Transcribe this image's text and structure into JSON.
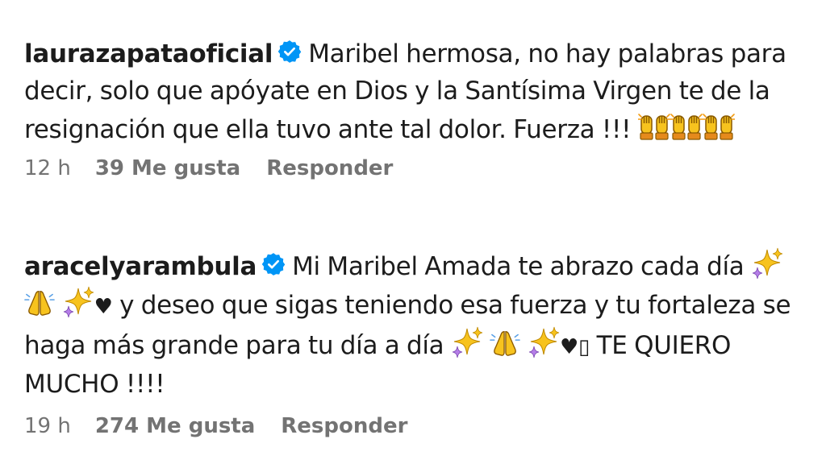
{
  "comments": [
    {
      "username": "laurazapataoficial",
      "text_before": "Maribel hermosa, no hay palabras para decir, solo que apóyate en Dios y la Santísima Virgen te de la resignación que ella tuvo ante tal dolor. Fuerza !!!",
      "time": "12 h",
      "likes": "39 Me gusta",
      "reply": "Responder",
      "icons": [
        "verified-badge-icon",
        "raising-hands-icon",
        "raising-hands-icon",
        "raising-hands-icon"
      ]
    },
    {
      "username": "aracelyarambula",
      "text_part1": "Mi Maribel Amada te abrazo cada día",
      "heart1": "♥",
      "text_part2": "y deseo que sigas teniendo esa fuerza y tu fortaleza se haga más grande para tu día a día",
      "heart2": "♥▯",
      "text_part3": "TE QUIERO MUCHO !!!!",
      "time": "19 h",
      "likes": "274 Me gusta",
      "reply": "Responder",
      "icons": [
        "verified-badge-icon",
        "sparkles-icon",
        "folded-hands-icon",
        "sparkles-icon",
        "heart-icon",
        "sparkles-icon",
        "folded-hands-icon",
        "sparkles-icon"
      ]
    }
  ],
  "colors": {
    "text": "#1c1c1c",
    "meta": "#737373",
    "verified": "#0095f6",
    "emoji_yellow": "#f7c31e",
    "emoji_orange": "#e58a1c"
  }
}
